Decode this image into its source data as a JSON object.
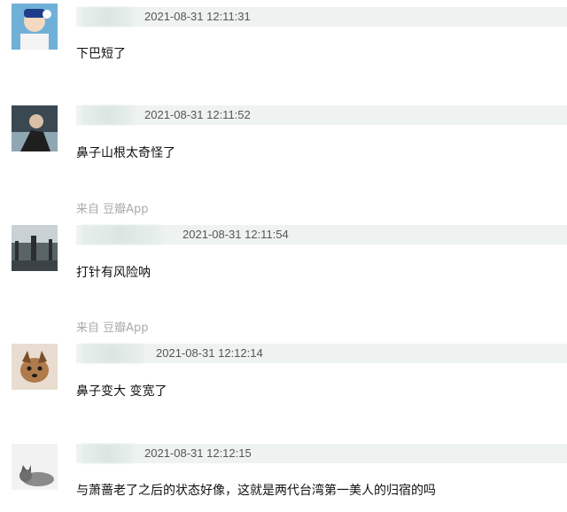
{
  "comments": [
    {
      "timestamp": "2021-08-31 12:11:31",
      "text": "下巴短了",
      "source": ""
    },
    {
      "timestamp": "2021-08-31 12:11:52",
      "text": "鼻子山根太奇怪了",
      "source": "来自 豆瓣App"
    },
    {
      "timestamp": "2021-08-31 12:11:54",
      "text": "打针有风险呐",
      "source": "来自 豆瓣App"
    },
    {
      "timestamp": "2021-08-31 12:12:14",
      "text": "鼻子变大 变宽了",
      "source": ""
    },
    {
      "timestamp": "2021-08-31 12:12:15",
      "text": "与萧蔷老了之后的状态好像，这就是两代台湾第一美人的归宿的吗",
      "source": ""
    }
  ]
}
